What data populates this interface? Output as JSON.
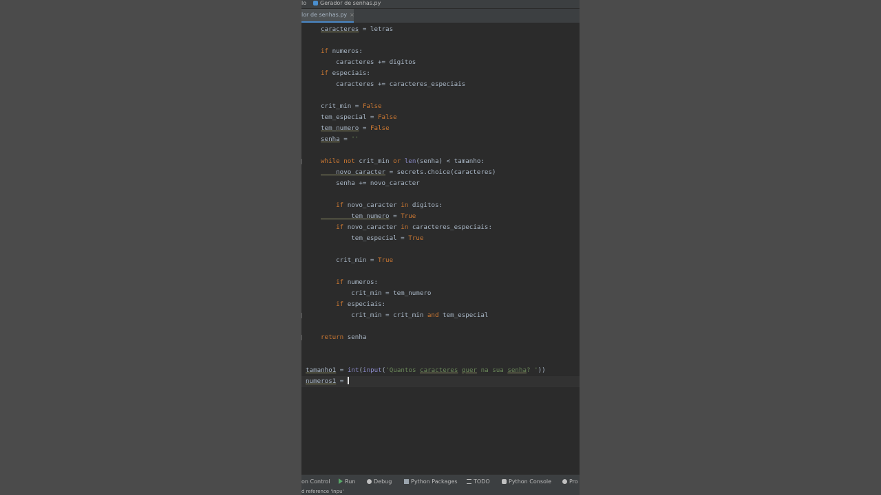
{
  "titlebar": {
    "crumb_prefix": "lo",
    "file": "Gerador de senhas.py"
  },
  "tab": {
    "label": "lor de senhas.py",
    "close": "×"
  },
  "code": {
    "l0": [
      "caracteres",
      " = letras"
    ],
    "l2": [
      "if",
      " numeros:"
    ],
    "l3": "    caracteres += digitos",
    "l4": [
      "if",
      " especiais:"
    ],
    "l5": "    caracteres += caracteres_especiais",
    "l7": [
      "crit_min = ",
      "False"
    ],
    "l8": [
      "tem_especial = ",
      "False"
    ],
    "l9": [
      "tem_numero",
      " = ",
      "False"
    ],
    "l10": [
      "senha",
      " = ",
      "''"
    ],
    "l12": [
      "while not",
      " crit_min ",
      "or",
      " ",
      "len",
      "(senha) < tamanho:"
    ],
    "l13": [
      "    novo_caracter",
      " = secrets.choice(caracteres)"
    ],
    "l14": "    senha += novo_caracter",
    "l16": [
      "    ",
      "if",
      " novo_caracter ",
      "in",
      " digitos:"
    ],
    "l17": [
      "        tem_numero",
      " = ",
      "True"
    ],
    "l18": [
      "    ",
      "if",
      " novo_caracter ",
      "in",
      " caracteres_especiais:"
    ],
    "l19": [
      "        tem_especial = ",
      "True"
    ],
    "l21": [
      "    crit_min = ",
      "True"
    ],
    "l23": [
      "    ",
      "if",
      " numeros:"
    ],
    "l24": "        crit_min = tem_numero",
    "l25": [
      "    ",
      "if",
      " especiais:"
    ],
    "l26": [
      "        crit_min = crit_min ",
      "and",
      " tem_especial"
    ],
    "l28": [
      "return",
      " senha"
    ],
    "l31": [
      "tamanho1",
      " = ",
      "int",
      "(",
      "input",
      "(",
      "'Quantos ",
      "caracteres",
      " ",
      "quer",
      " na sua ",
      "senha",
      "? '",
      "))"
    ],
    "l32": [
      "numeros1",
      " = "
    ]
  },
  "toolwindows": [
    {
      "label": "on Control",
      "icon": "branch-icon"
    },
    {
      "label": "Run",
      "icon": "run-icon"
    },
    {
      "label": "Debug",
      "icon": "debug-icon"
    },
    {
      "label": "Python Packages",
      "icon": "packages-icon"
    },
    {
      "label": "TODO",
      "icon": "todo-icon"
    },
    {
      "label": "Python Console",
      "icon": "console-icon"
    },
    {
      "label": "Pro",
      "icon": "problems-icon"
    }
  ],
  "status": {
    "message": "d reference 'inpu'"
  },
  "colors": {
    "keyword": "#cc7832",
    "builtin": "#8888c6",
    "string": "#6a8759",
    "text": "#a9b7c6",
    "editor_bg": "#2b2b2b"
  }
}
